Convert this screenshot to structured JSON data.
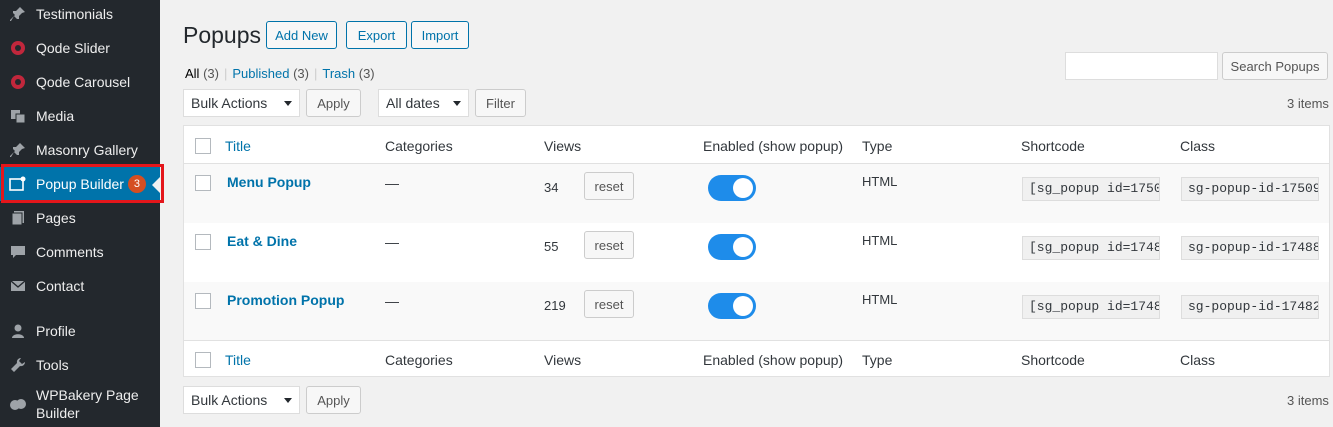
{
  "sidebar": {
    "items": [
      {
        "label": "Testimonials",
        "icon": "pin-icon"
      },
      {
        "label": "Qode Slider",
        "icon": "qode-icon"
      },
      {
        "label": "Qode Carousel",
        "icon": "qode-icon"
      },
      {
        "label": "Media",
        "icon": "media-icon"
      },
      {
        "label": "Masonry Gallery",
        "icon": "pin-icon"
      },
      {
        "label": "Popup Builder",
        "icon": "popup-icon",
        "badge": "3",
        "active": true
      },
      {
        "label": "Pages",
        "icon": "pages-icon"
      },
      {
        "label": "Comments",
        "icon": "comments-icon"
      },
      {
        "label": "Contact",
        "icon": "mail-icon"
      },
      {
        "label": "Profile",
        "icon": "user-icon"
      },
      {
        "label": "Tools",
        "icon": "wrench-icon"
      },
      {
        "label": "WPBakery Page Builder",
        "icon": "bakery-icon"
      }
    ]
  },
  "header": {
    "title": "Popups",
    "add_new": "Add New",
    "export": "Export",
    "import": "Import"
  },
  "filters_status": {
    "all": "All",
    "all_count": "(3)",
    "published": "Published",
    "published_count": "(3)",
    "trash": "Trash",
    "trash_count": "(3)",
    "sep": "|"
  },
  "search": {
    "button": "Search Popups",
    "value": ""
  },
  "top_actions": {
    "bulk": "Bulk Actions",
    "apply": "Apply",
    "dates": "All dates",
    "filter": "Filter",
    "items": "3 items"
  },
  "bottom_actions": {
    "bulk": "Bulk Actions",
    "apply": "Apply",
    "items": "3 items"
  },
  "table": {
    "columns": [
      "Title",
      "Categories",
      "Views",
      "Enabled (show popup)",
      "Type",
      "Shortcode",
      "Class"
    ],
    "rows": [
      {
        "title": "Menu Popup",
        "categories": "—",
        "views": "34",
        "reset": "reset",
        "enabled": true,
        "type": "HTML",
        "shortcode": "[sg_popup id=1750",
        "class": "sg-popup-id-17509"
      },
      {
        "title": "Eat & Dine",
        "categories": "—",
        "views": "55",
        "reset": "reset",
        "enabled": true,
        "type": "HTML",
        "shortcode": "[sg_popup id=1748",
        "class": "sg-popup-id-17488"
      },
      {
        "title": "Promotion Popup",
        "categories": "—",
        "views": "219",
        "reset": "reset",
        "enabled": true,
        "type": "HTML",
        "shortcode": "[sg_popup id=1748",
        "class": "sg-popup-id-17482"
      }
    ]
  },
  "colors": {
    "accent": "#0073aa",
    "toggle_on": "#1e8cea",
    "highlight": "#e4161b",
    "badge": "#d54e21"
  }
}
